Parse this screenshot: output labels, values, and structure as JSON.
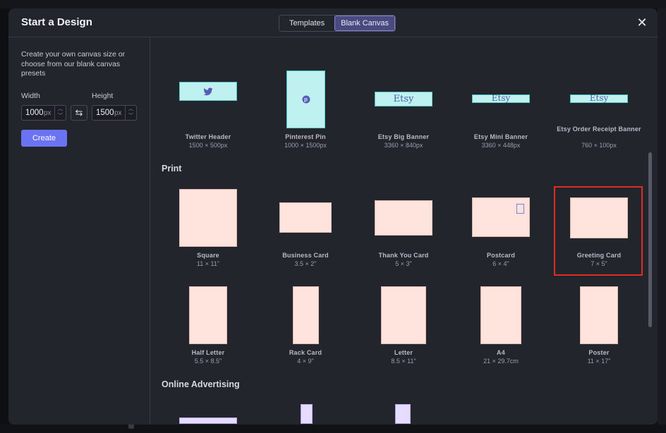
{
  "header": {
    "title": "Start a Design",
    "tabs": [
      {
        "label": "Templates",
        "active": false
      },
      {
        "label": "Blank Canvas",
        "active": true
      }
    ],
    "close_icon": "close-icon"
  },
  "sidebar": {
    "description": "Create your own canvas size or choose from our blank canvas presets",
    "width_label": "Width",
    "height_label": "Height",
    "width_value": "1000",
    "height_value": "1500",
    "unit": "px",
    "create_label": "Create",
    "colors": {
      "accent": "#6c73f2"
    }
  },
  "sections": {
    "print_label": "Print",
    "online_advertising_label": "Online Advertising"
  },
  "social": [
    {
      "name": "Twitter Header",
      "size": "1500 × 500px",
      "icon": "twitter-icon"
    },
    {
      "name": "Pinterest Pin",
      "size": "1000 × 1500px",
      "icon": "pinterest-icon"
    },
    {
      "name": "Etsy Big Banner",
      "size": "3360 × 840px",
      "mark": "Etsy"
    },
    {
      "name": "Etsy Mini Banner",
      "size": "3360 × 448px",
      "mark": "Etsy"
    },
    {
      "name": "Etsy Order Receipt Banner",
      "size": "760 × 100px",
      "mark": "Etsy"
    }
  ],
  "print": [
    {
      "name": "Square",
      "size": "11 × 11\""
    },
    {
      "name": "Business Card",
      "size": "3.5 × 2\""
    },
    {
      "name": "Thank You Card",
      "size": "5 × 3\""
    },
    {
      "name": "Postcard",
      "size": "6 × 4\""
    },
    {
      "name": "Greeting Card",
      "size": "7 × 5\"",
      "highlighted": true
    },
    {
      "name": "Half Letter",
      "size": "5.5 × 8.5\""
    },
    {
      "name": "Rack Card",
      "size": "4 × 9\""
    },
    {
      "name": "Letter",
      "size": "8.5 × 11\""
    },
    {
      "name": "A4",
      "size": "21 × 29.7cm"
    },
    {
      "name": "Poster",
      "size": "11 × 17\""
    }
  ]
}
